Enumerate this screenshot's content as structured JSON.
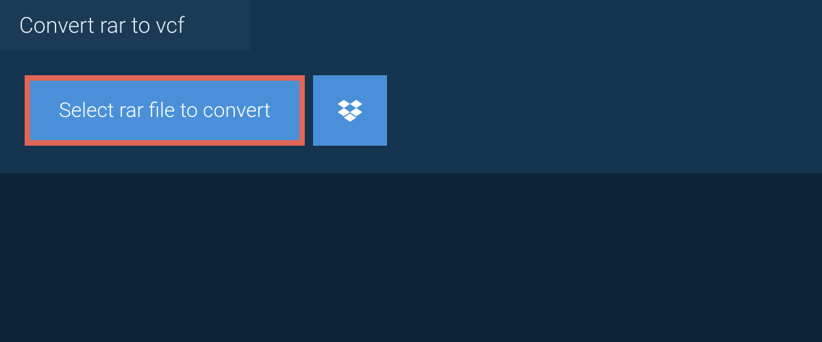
{
  "header": {
    "title": "Convert rar to vcf"
  },
  "actions": {
    "select_file_label": "Select rar file to convert",
    "dropbox_icon_name": "dropbox-icon"
  },
  "colors": {
    "background": "#0d2438",
    "panel": "#153450",
    "tab": "#1a3a56",
    "button": "#4a90d9",
    "highlight_border": "#e06657",
    "text": "#e8eef3"
  }
}
